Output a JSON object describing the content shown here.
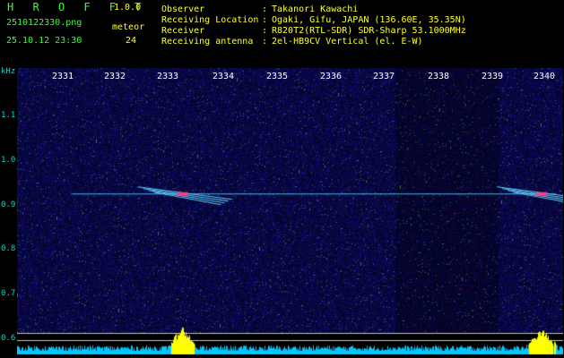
{
  "header": {
    "app_title": "H R O F F T",
    "app_version": "1.0.0",
    "file_name": "2510122330.png",
    "date_time": "25.10.12 23:30",
    "meteor_label": "meteor",
    "meteor_count": "24"
  },
  "info": [
    {
      "key": "Observer",
      "value": "Takanori Kawachi"
    },
    {
      "key": "Receiving Location",
      "value": "Ogaki, Gifu, JAPAN (136.60E, 35.35N)"
    },
    {
      "key": "Receiver",
      "value": "R820T2(RTL-SDR) SDR-Sharp 53.1000MHz"
    },
    {
      "key": "Receiving antenna",
      "value": "2el-HB9CV Vertical (el. E-W)"
    }
  ],
  "chart_data": {
    "type": "heatmap",
    "title": "",
    "xlabel": "",
    "ylabel": "kHz",
    "x_ticks": [
      "2331",
      "2332",
      "2333",
      "2334",
      "2335",
      "2336",
      "2337",
      "2338",
      "2339",
      "2340"
    ],
    "y_ticks": [
      "1.1",
      "1.0",
      "0.9",
      "0.8",
      "0.7",
      "0.6"
    ],
    "ylim": [
      0.58,
      1.19
    ],
    "carrier_khz": 0.9,
    "meteor_echoes": [
      {
        "time": "2333.2",
        "khz": 0.9
      },
      {
        "time": "2339.8",
        "khz": 0.9
      }
    ]
  },
  "colors": {
    "background": "#000000",
    "noise": "#1c1c8c",
    "carrier": "#5ad0ff",
    "meteor": "#ff4080",
    "spectrum": "#00c8ff",
    "peak": "#ffff00"
  },
  "labels": {
    "khz": "kHz"
  }
}
